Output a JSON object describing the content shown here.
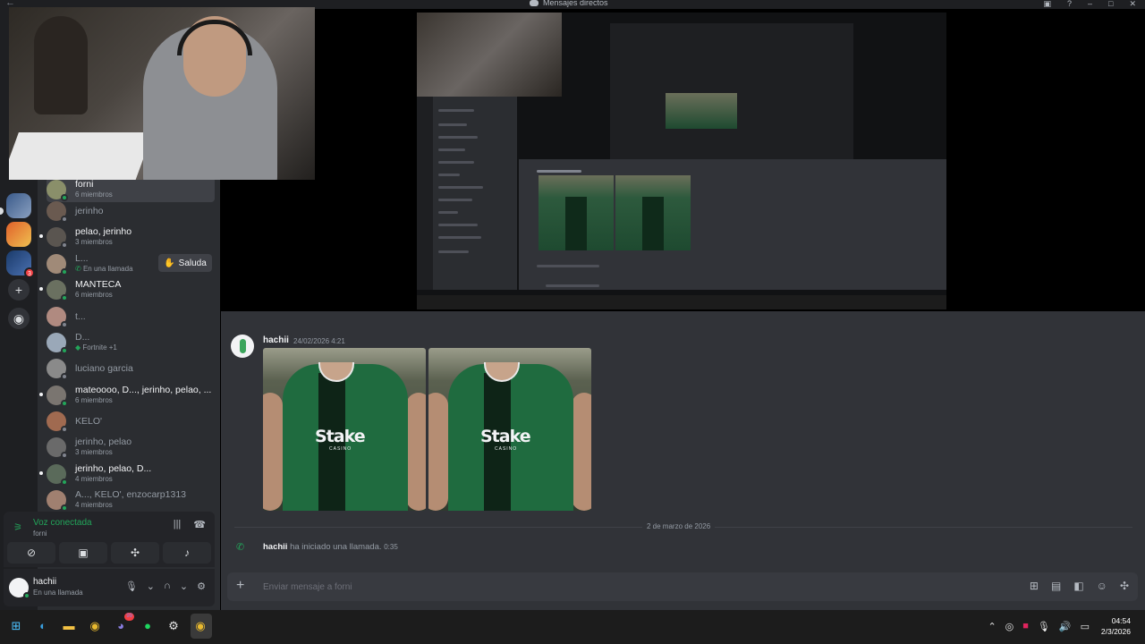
{
  "window": {
    "title": "Mensajes directos",
    "title_stream_copy": "Mensajes directos"
  },
  "dms": [
    {
      "name": "forni",
      "sub": "6 miembros",
      "bold": true
    },
    {
      "name": "jerinho",
      "sub": "",
      "bold": false
    },
    {
      "name": "pelao, jerinho",
      "sub": "3 miembros",
      "bold": true
    },
    {
      "name": "L...",
      "sub": "En una llamada",
      "bold": false
    },
    {
      "name": "MANTECA",
      "sub": "6 miembros",
      "bold": true
    },
    {
      "name": "t...",
      "sub": "",
      "bold": false
    },
    {
      "name": "D...",
      "sub": "Fortnite +1",
      "bold": false
    },
    {
      "name": "luciano garcia",
      "sub": "",
      "bold": false
    },
    {
      "name": "mateoooo, D..., jerinho, pelao, ...",
      "sub": "6 miembros",
      "bold": true
    },
    {
      "name": "KELO'",
      "sub": "",
      "bold": false
    },
    {
      "name": "jerinho, pelao",
      "sub": "3 miembros",
      "bold": false
    },
    {
      "name": "jerinho, pelao, D...",
      "sub": "4 miembros",
      "bold": true
    },
    {
      "name": "A..., KELO', enzocarp1313",
      "sub": "4 miembros",
      "bold": false
    }
  ],
  "saluda_label": "Saluda",
  "voice": {
    "status": "Voz conectada",
    "channel": "forni"
  },
  "user": {
    "name": "hachii",
    "status": "En una llamada"
  },
  "message": {
    "author": "hachii",
    "timestamp": "24/02/2026 4:21",
    "jersey_brand": "Stake",
    "jersey_sub": "CASINO"
  },
  "divider_date": "2 de marzo de 2026",
  "call": {
    "author": "hachii",
    "text": "ha iniciado una llamada.",
    "duration": "0:35"
  },
  "composer": {
    "placeholder": "Enviar mensaje a forni"
  },
  "taskbar": {
    "time": "04:54",
    "date": "2/3/2026",
    "discord_badge": "99"
  },
  "colors": {
    "accent_green": "#23a55a",
    "background": "#313338",
    "sidebar": "#2b2d31",
    "jersey": "#1f6b3f"
  }
}
